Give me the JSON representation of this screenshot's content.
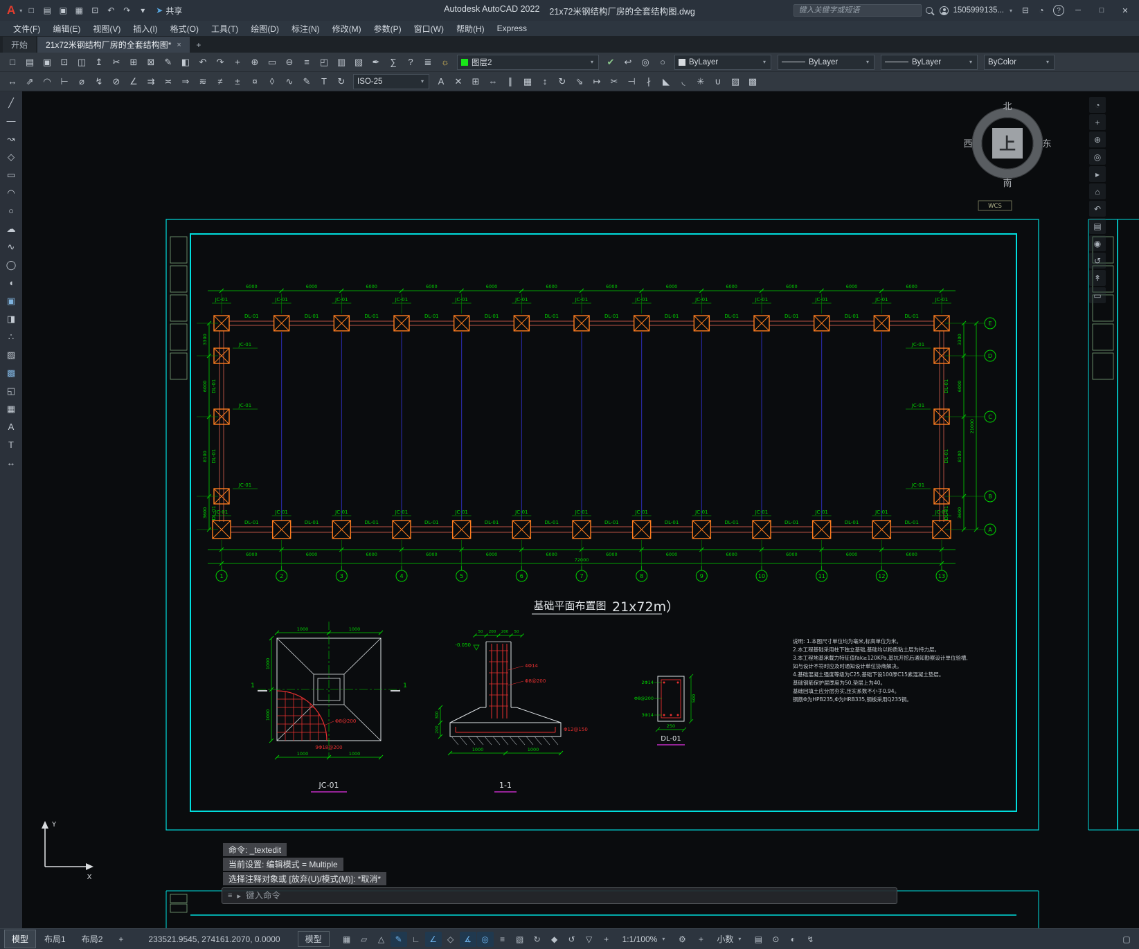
{
  "titlebar": {
    "logo": "A",
    "logo_caret": "▾",
    "qat": [
      {
        "n": "qnew-icon",
        "g": "□"
      },
      {
        "n": "open-file-icon",
        "g": "▤"
      },
      {
        "n": "qsave-icon",
        "g": "▣"
      },
      {
        "n": "save-as-icon",
        "g": "▦"
      },
      {
        "n": "plot-icon",
        "g": "⊡"
      },
      {
        "n": "undo-icon",
        "g": "↶"
      },
      {
        "n": "redo-icon",
        "g": "↷"
      },
      {
        "n": "qat-customize-caret",
        "g": "▾"
      }
    ],
    "share_icon": "➤",
    "share_label": "共享",
    "app_title": "Autodesk AutoCAD 2022",
    "doc_title": "21x72米钢结构厂房的全套结构图.dwg",
    "search_placeholder": "键入关键字或短语",
    "account_label": "1505999135...",
    "account_caret": "▾",
    "right_icons": [
      {
        "n": "app-store-icon",
        "g": "⊟"
      },
      {
        "n": "notifications-bell-icon",
        "g": "◔"
      }
    ],
    "help_glyph": "?",
    "window_min": "─",
    "window_max": "□",
    "window_close": "✕"
  },
  "menubar": {
    "items": [
      {
        "id": "file",
        "label": "文件(F)"
      },
      {
        "id": "edit",
        "label": "编辑(E)"
      },
      {
        "id": "view",
        "label": "视图(V)"
      },
      {
        "id": "insert",
        "label": "插入(I)"
      },
      {
        "id": "format",
        "label": "格式(O)"
      },
      {
        "id": "tools",
        "label": "工具(T)"
      },
      {
        "id": "draw",
        "label": "绘图(D)"
      },
      {
        "id": "dimension",
        "label": "标注(N)"
      },
      {
        "id": "modify",
        "label": "修改(M)"
      },
      {
        "id": "parametric",
        "label": "参数(P)"
      },
      {
        "id": "window",
        "label": "窗口(W)"
      },
      {
        "id": "help",
        "label": "帮助(H)"
      },
      {
        "id": "express",
        "label": "Express"
      }
    ]
  },
  "doc_tabs": {
    "home": "开始",
    "active_doc": "21x72米钢结构厂房的全套结构图*",
    "close": "×",
    "add": "+"
  },
  "toolbar1": {
    "icons": [
      {
        "n": "qnew-icon",
        "g": "□"
      },
      {
        "n": "open-icon",
        "g": "▤"
      },
      {
        "n": "save-icon",
        "g": "▣"
      },
      {
        "n": "plot-icon",
        "g": "⊡"
      },
      {
        "n": "plot-preview-icon",
        "g": "◫"
      },
      {
        "n": "publish-icon",
        "g": "↥"
      },
      {
        "n": "cut-clip-icon",
        "g": "✂"
      },
      {
        "n": "copy-clip-icon",
        "g": "⊞"
      },
      {
        "n": "paste-clip-icon",
        "g": "⊠"
      },
      {
        "n": "match-properties-icon",
        "g": "✎"
      },
      {
        "n": "block-editor-icon",
        "g": "◧"
      },
      {
        "n": "undo-icon",
        "g": "↶"
      },
      {
        "n": "redo-icon",
        "g": "↷"
      },
      {
        "n": "pan-icon",
        "g": "+"
      },
      {
        "n": "zoom-realtime-icon",
        "g": "⊕"
      },
      {
        "n": "zoom-window-icon",
        "g": "▭"
      },
      {
        "n": "zoom-previous-icon",
        "g": "⊖"
      },
      {
        "n": "properties-palette-icon",
        "g": "≡"
      },
      {
        "n": "designcenter-icon",
        "g": "◰"
      },
      {
        "n": "tool-palettes-icon",
        "g": "▥"
      },
      {
        "n": "sheet-set-manager-icon",
        "g": "▧"
      },
      {
        "n": "markup-icon",
        "g": "✒"
      },
      {
        "n": "quick-calc-icon",
        "g": "∑"
      },
      {
        "n": "help-icon",
        "g": "?"
      }
    ],
    "layer_tools": [
      {
        "n": "layer-properties-manager-icon",
        "g": "≣"
      },
      {
        "n": "layer-states-icon",
        "g": "☼",
        "c": "#e2c25a"
      }
    ],
    "layer_combo": {
      "label": "图层2",
      "swatch": "#19e619",
      "caret": "▾"
    },
    "layer_icons": [
      {
        "n": "set-current-layer-icon",
        "g": "✔",
        "c": "#8cc98c"
      },
      {
        "n": "layer-previous-icon",
        "g": "↩"
      },
      {
        "n": "layer-isolate-icon",
        "g": "◎"
      },
      {
        "n": "layer-unisolate-icon",
        "g": "○"
      }
    ],
    "color_combo": {
      "label": "ByLayer",
      "swatch": "#d7dbe0",
      "caret": "▾"
    },
    "linetype_combo": {
      "label": "ByLayer",
      "caret": "▾"
    },
    "lineweight_combo": {
      "label": "ByLayer",
      "caret": "▾"
    },
    "plotstyle_combo": {
      "label": "ByColor",
      "caret": "▾"
    }
  },
  "toolbar2": {
    "icons_left": [
      {
        "n": "linear-dimension-icon",
        "g": "↔"
      },
      {
        "n": "aligned-dimension-icon",
        "g": "⇗"
      },
      {
        "n": "arc-length-dimension-icon",
        "g": "◠"
      },
      {
        "n": "ordinate-dimension-icon",
        "g": "⊢"
      },
      {
        "n": "radius-dimension-icon",
        "g": "⌀"
      },
      {
        "n": "jogged-dimension-icon",
        "g": "↯"
      },
      {
        "n": "diameter-dimension-icon",
        "g": "⊘"
      },
      {
        "n": "angular-dimension-icon",
        "g": "∠"
      },
      {
        "n": "quick-dimension-icon",
        "g": "⇉"
      },
      {
        "n": "baseline-dimension-icon",
        "g": "≍"
      },
      {
        "n": "continue-dimension-icon",
        "g": "⇒"
      },
      {
        "n": "dimension-space-icon",
        "g": "≋"
      },
      {
        "n": "dimension-break-icon",
        "g": "≠"
      },
      {
        "n": "tolerance-icon",
        "g": "±"
      },
      {
        "n": "center-mark-icon",
        "g": "¤"
      },
      {
        "n": "inspection-icon",
        "g": "◊"
      },
      {
        "n": "jogged-linear-icon",
        "g": "∿"
      },
      {
        "n": "dimension-edit-icon",
        "g": "✎"
      },
      {
        "n": "dimension-text-edit-icon",
        "g": "T"
      },
      {
        "n": "dimension-update-icon",
        "g": "↻"
      }
    ],
    "dimstyle_combo": {
      "label": "ISO-25",
      "caret": "▾"
    },
    "icons_right": [
      {
        "n": "text-style-icon",
        "g": "A"
      },
      {
        "n": "erase-icon",
        "g": "✕"
      },
      {
        "n": "copy-icon",
        "g": "⊞"
      },
      {
        "n": "mirror-icon",
        "g": "⇔"
      },
      {
        "n": "offset-icon",
        "g": "∥"
      },
      {
        "n": "array-icon",
        "g": "▦"
      },
      {
        "n": "move-icon",
        "g": "↕"
      },
      {
        "n": "rotate-icon",
        "g": "↻"
      },
      {
        "n": "scale-icon",
        "g": "⇘"
      },
      {
        "n": "stretch-icon",
        "g": "↦"
      },
      {
        "n": "trim-icon",
        "g": "✂"
      },
      {
        "n": "extend-icon",
        "g": "⊣"
      },
      {
        "n": "break-icon",
        "g": "∤"
      },
      {
        "n": "chamfer-icon",
        "g": "◣"
      },
      {
        "n": "fillet-icon",
        "g": "◟"
      },
      {
        "n": "explode-icon",
        "g": "✳"
      },
      {
        "n": "join-icon",
        "g": "∪"
      },
      {
        "n": "hatch-icon",
        "g": "▨"
      },
      {
        "n": "gradient-icon",
        "g": "▩"
      }
    ]
  },
  "left_palette": {
    "icons": [
      {
        "n": "line-tool-icon",
        "g": "╱"
      },
      {
        "n": "construction-line-icon",
        "g": "―"
      },
      {
        "n": "polyline-icon",
        "g": "↝"
      },
      {
        "n": "polygon-icon",
        "g": "◇"
      },
      {
        "n": "rectangle-icon",
        "g": "▭"
      },
      {
        "n": "arc-icon",
        "g": "◠"
      },
      {
        "n": "circle-icon",
        "g": "○"
      },
      {
        "n": "revision-cloud-icon",
        "g": "☁"
      },
      {
        "n": "spline-icon",
        "g": "∿"
      },
      {
        "n": "ellipse-icon",
        "g": "◯"
      },
      {
        "n": "ellipse-arc-icon",
        "g": "◖"
      },
      {
        "n": "insert-block-icon",
        "g": "▣",
        "c": "#7fb2dd"
      },
      {
        "n": "create-block-icon",
        "g": "◨"
      },
      {
        "n": "point-icon",
        "g": "∴"
      },
      {
        "n": "hatch-tool-icon",
        "g": "▨"
      },
      {
        "n": "gradient-tool-icon",
        "g": "▩",
        "c": "#7fb2dd"
      },
      {
        "n": "region-icon",
        "g": "◱"
      },
      {
        "n": "table-icon",
        "g": "▦"
      },
      {
        "n": "text-tool-icon",
        "g": "A"
      },
      {
        "n": "mtext-icon",
        "g": "T"
      },
      {
        "n": "dimension-tool-icon",
        "g": "↔"
      }
    ]
  },
  "navbar": {
    "icons": [
      {
        "n": "navigation-wheel-icon",
        "g": "◔"
      },
      {
        "n": "pan-hand-icon",
        "g": "+"
      },
      {
        "n": "zoom-icon",
        "g": "⊕"
      },
      {
        "n": "orbit-icon",
        "g": "◎"
      },
      {
        "n": "show-motion-icon",
        "g": "▸"
      },
      {
        "n": "viewcube-home-icon",
        "g": "⌂"
      },
      {
        "n": "previous-view-icon",
        "g": "↶"
      },
      {
        "n": "named-views-icon",
        "g": "▤"
      },
      {
        "n": "free-orbit-icon",
        "g": "◉"
      },
      {
        "n": "swivel-icon",
        "g": "↺"
      },
      {
        "n": "walk-icon",
        "g": "↟"
      },
      {
        "n": "zoom-extents-icon",
        "g": "▭"
      }
    ]
  },
  "command": {
    "history": [
      "命令: _textedit",
      "当前设置: 编辑模式 = Multiple",
      "选择注释对象或 [放弃(U)/模式(M)]: *取消*"
    ],
    "customize_icon": "≡",
    "prompt_caret": "▸",
    "placeholder": "键入命令"
  },
  "statusbar": {
    "layout_tabs": [
      {
        "id": "model",
        "label": "模型",
        "active": true
      },
      {
        "id": "layout1",
        "label": "布局1",
        "active": false
      },
      {
        "id": "layout2",
        "label": "布局2",
        "active": false
      },
      {
        "id": "add-layout",
        "label": "+",
        "active": false
      }
    ],
    "coordinates": "233521.9545, 274161.2070, 0.0000",
    "model_button": "模型",
    "toggles": [
      {
        "n": "grid-display-icon",
        "g": "▦",
        "a": false
      },
      {
        "n": "snap-mode-icon",
        "g": "▱",
        "a": false
      },
      {
        "n": "infer-constraints-icon",
        "g": "△",
        "a": false
      },
      {
        "n": "dynamic-input-icon",
        "g": "✎",
        "a": true
      },
      {
        "n": "ortho-mode-icon",
        "g": "∟",
        "a": false
      },
      {
        "n": "polar-tracking-icon",
        "g": "∠",
        "a": true
      },
      {
        "n": "isometric-drafting-icon",
        "g": "◇",
        "a": false
      },
      {
        "n": "object-snap-tracking-icon",
        "g": "∡",
        "a": true
      },
      {
        "n": "object-snap-icon",
        "g": "◎",
        "a": true
      },
      {
        "n": "lineweight-display-icon",
        "g": "≡",
        "a": false
      },
      {
        "n": "transparency-icon",
        "g": "▧",
        "a": false
      },
      {
        "n": "selection-cycling-icon",
        "g": "↻",
        "a": false
      },
      {
        "n": "3d-object-snap-icon",
        "g": "◆",
        "a": false
      },
      {
        "n": "dynamic-ucs-icon",
        "g": "↺",
        "a": false
      },
      {
        "n": "selection-filter-icon",
        "g": "▽",
        "a": false
      },
      {
        "n": "gizmo-icon",
        "g": "+",
        "a": false
      }
    ],
    "scale": {
      "label": "1:1/100%",
      "caret": "▾"
    },
    "workspace_gear": "⚙",
    "annotation_add": "+",
    "units": {
      "label": "小数",
      "caret": "▾"
    },
    "toggles2": [
      {
        "n": "quick-properties-icon",
        "g": "▤"
      },
      {
        "n": "lock-ui-icon",
        "g": "⊙"
      },
      {
        "n": "isolate-objects-icon",
        "g": "◐"
      },
      {
        "n": "hardware-acceleration-icon",
        "g": "↯"
      }
    ],
    "clean_screen": "▢"
  },
  "drawing": {
    "compass": {
      "north": "北",
      "south": "南",
      "west": "西",
      "east": "东",
      "up": "上"
    },
    "wcs_label": "WCS",
    "ucs": {
      "x": "X",
      "y": "Y"
    },
    "plan": {
      "footing_label": "JC-01",
      "beam_label": "DL-01",
      "col_axes": [
        "1",
        "2",
        "3",
        "4",
        "5",
        "6",
        "7",
        "8",
        "9",
        "10",
        "11",
        "12",
        "13"
      ],
      "row_axes": [
        "A",
        "B",
        "C",
        "D",
        "E"
      ],
      "bay_dim": "6000",
      "total_width_dim": "72000",
      "side_dims": [
        "3300",
        "6000",
        "8100",
        "3600"
      ],
      "total_height_dim": "21000",
      "title": "基础平面布置图",
      "title_scale": "21x72m）"
    },
    "details": {
      "jc": {
        "label": "JC-01",
        "dim": "1000",
        "cut_mark": "1",
        "rebar_arc": "Φ8@200",
        "rebar_bottom": "9Φ18@200"
      },
      "section": {
        "label": "1-1",
        "top_dims": [
          "50",
          "200",
          "200",
          "50"
        ],
        "level": "-0.050",
        "bar_labels": [
          "4Φ14",
          "Φ8@200"
        ],
        "slab_bar": "Φ12@150",
        "bottom_dims": [
          "1000",
          "1000"
        ],
        "left_dims": [
          "300",
          "200"
        ]
      },
      "dl": {
        "label": "DL-01",
        "bar_labels": [
          "2Φ14",
          "Φ8@200",
          "3Φ14"
        ],
        "width_dim": "250",
        "height_dim": "500"
      }
    },
    "notes": [
      "说明: 1.本图尺寸单位均为毫米,标高单位为米。",
      "2.本工程基础采用柱下独立基础,基础均以粉质粘土层为持力层。",
      "3.本工程地基承载力特征值fak≥120KPa,基坑开挖后通知勘察设计单位验槽,",
      "   如与设计不符时应及时通知设计单位协商解决。",
      "4.基础混凝土强度等级为C25,基础下设100厚C15素混凝土垫层。",
      "   基础钢筋保护层厚度为50,垫层上为40。",
      "   基础回填土应分层夯实,压实系数不小于0.94。",
      "   钢筋Φ为HPB235,Φ为HRB335,钢板采用Q235钢。"
    ]
  }
}
